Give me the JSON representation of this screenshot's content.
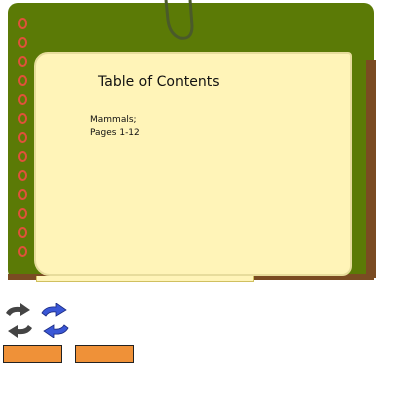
{
  "notebook": {
    "page_title": "Table of Contents",
    "entries": [
      {
        "line1": "Mammals;",
        "line2": "Pages 1-12"
      }
    ]
  },
  "colors": {
    "cover": "#5b7a06",
    "page": "#fff4b8",
    "rings": "#e0523a",
    "icon_dark": "#444444",
    "icon_blue": "#3a57d6",
    "button": "#ef9138"
  },
  "controls": {
    "icons": [
      "redo-arrow-dark-icon",
      "redo-arrow-blue-icon",
      "undo-arrow-dark-icon",
      "undo-arrow-blue-icon"
    ],
    "buttons": [
      "orange-button-1",
      "orange-button-2"
    ]
  }
}
